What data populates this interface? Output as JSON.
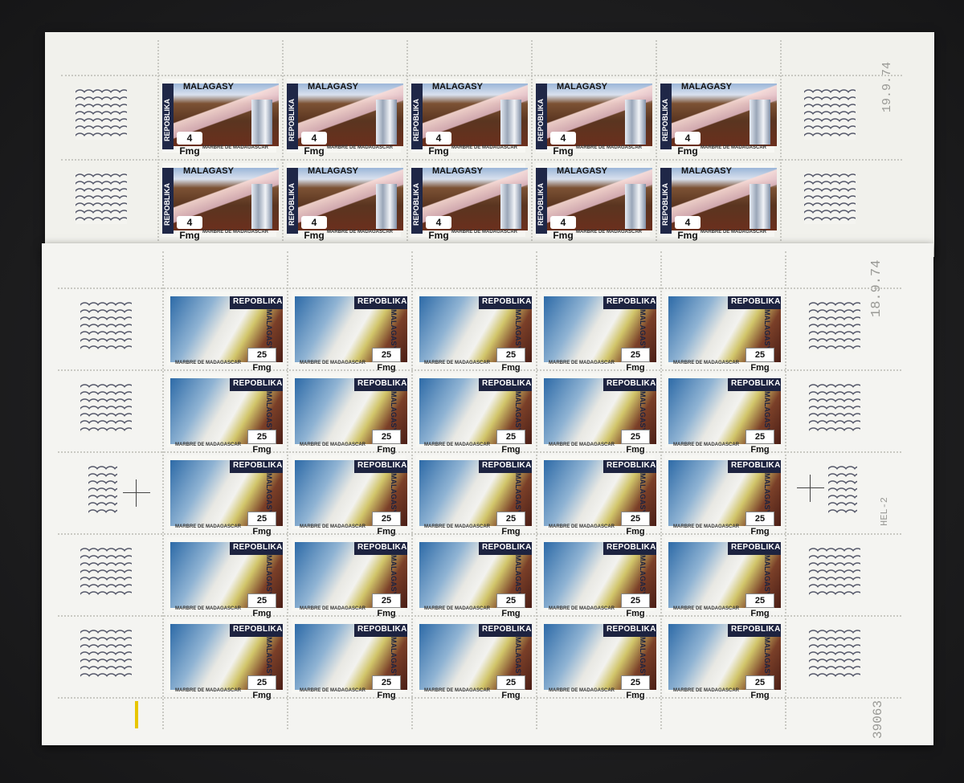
{
  "top_sheet": {
    "date": "19.9.74",
    "stamp": {
      "country_horizontal": "MALAGASY",
      "country_vertical": "REPOBLIKA",
      "value": "4 Fmg",
      "caption": "MARBRE DE MADAGASCAR",
      "accent": "#1f2747"
    },
    "rows": 2,
    "cols": 5
  },
  "bottom_sheet": {
    "date": "18.9.74",
    "plate_code": "HEL-2",
    "control_number": "39063",
    "stamp": {
      "country_horizontal": "REPOBLIKA",
      "country_vertical": "MALAGASY",
      "value": "25 Fmg",
      "caption": "MARBRE DE MADAGASCAR",
      "accent": "#1d2340"
    },
    "rows": 5,
    "cols": 5
  },
  "colors": {
    "background": "#1c1c1d",
    "sheet": "#f4f4f1",
    "marker": "#e8c600"
  }
}
